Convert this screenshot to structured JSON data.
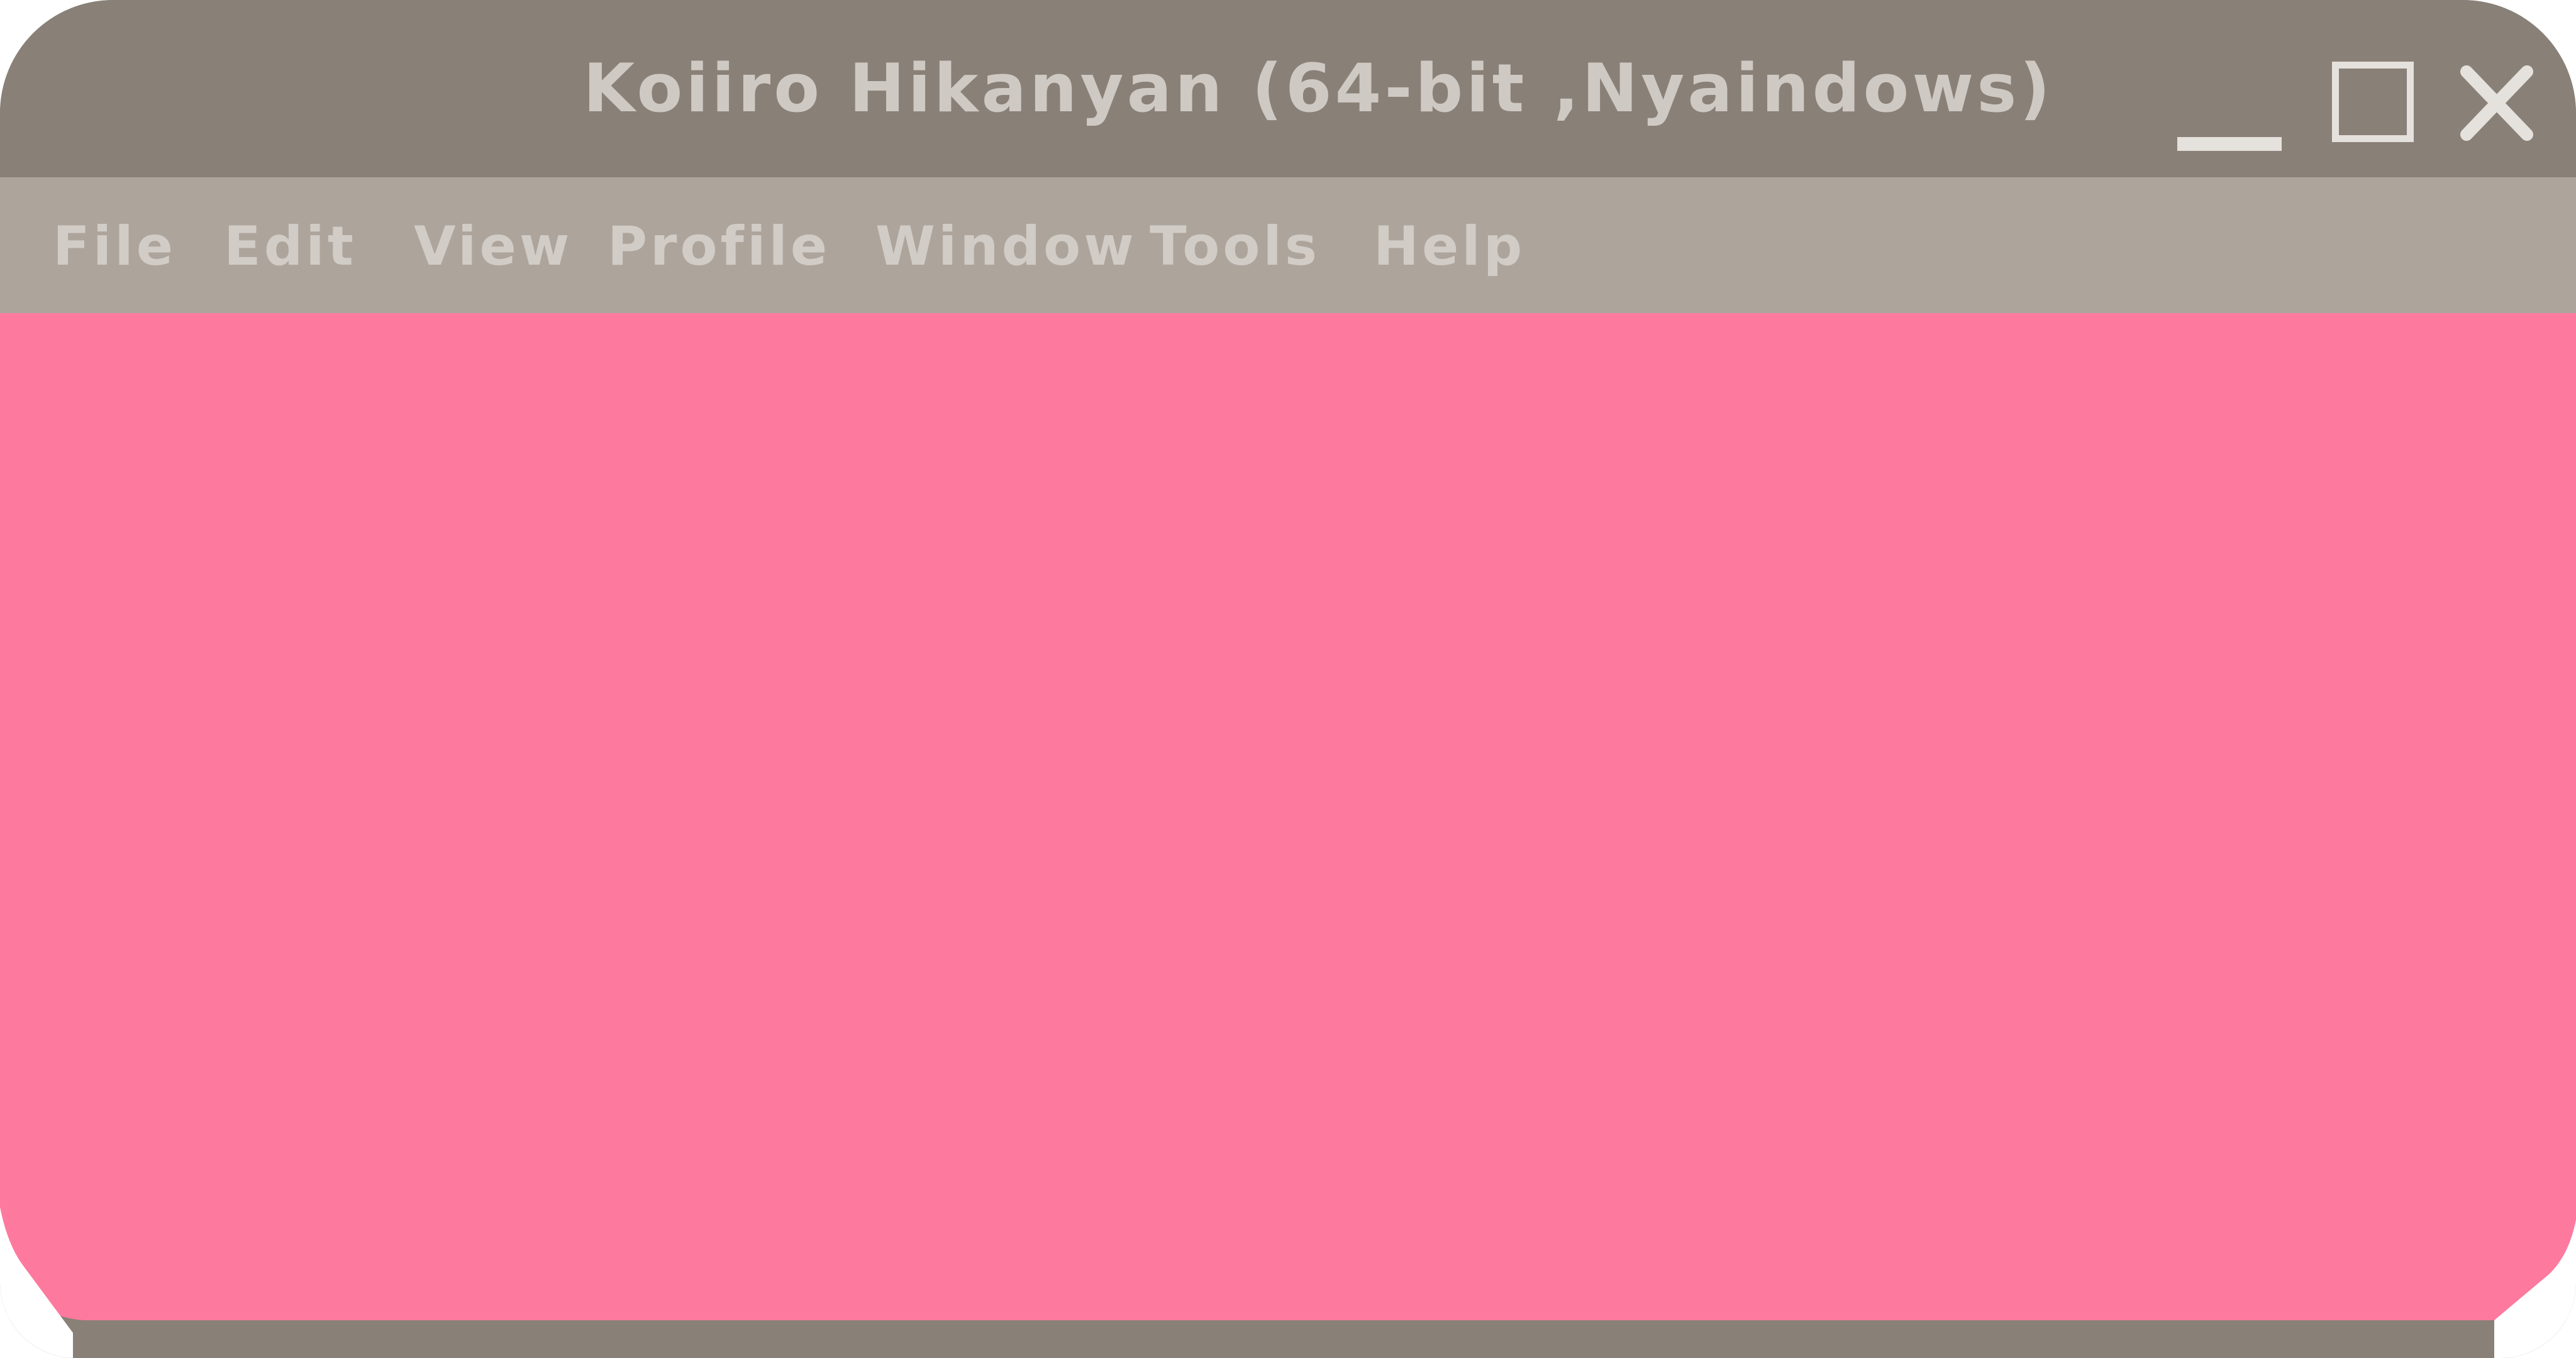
{
  "window": {
    "title": "Koiiro Hikanyan (64-bit ,Nyaindows)",
    "controls": {
      "minimize_icon": "minimize-icon",
      "maximize_icon": "maximize-icon",
      "close_icon": "close-icon"
    }
  },
  "menu": {
    "items": [
      {
        "label": "File"
      },
      {
        "label": "Edit"
      },
      {
        "label": "View"
      },
      {
        "label": "Profile"
      },
      {
        "label": "Window"
      },
      {
        "label": "Tools"
      },
      {
        "label": "Help"
      }
    ]
  },
  "colors": {
    "titlebar": "#898077",
    "menubar": "#ada59c",
    "content": "#fd7a9e",
    "text": "#d1ccc6",
    "controls": "#e5e1dd"
  }
}
